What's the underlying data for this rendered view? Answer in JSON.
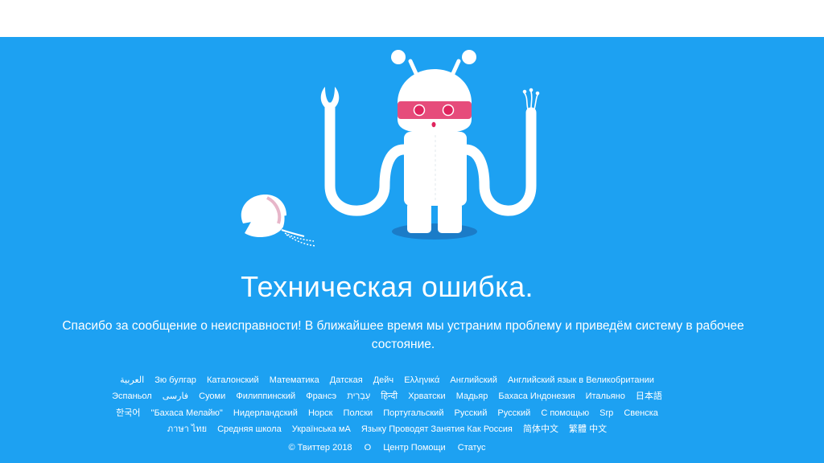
{
  "colors": {
    "background": "#1da1f2",
    "robot_body": "#ffffff",
    "visor": "#e0245e",
    "shadow": "#1b7cc8"
  },
  "illustration": {
    "name": "broken-twitter-robot",
    "icon": "robot-icon"
  },
  "error": {
    "title": "Техническая ошибка.",
    "message": "Спасибо за сообщение о неисправности! В ближайшее время мы устраним проблему и приведём систему в рабочее состояние."
  },
  "languages": [
    "العربية",
    "Зю булгар",
    "Каталонский",
    "Математика",
    "Датская",
    "Дейч",
    "Ελληνικά",
    "Английский",
    "Английский язык в Великобритании",
    "Эспаньол",
    "فارسی",
    "Суоми",
    "Филиппинский",
    "Франсэ",
    "עִבְרִית",
    "हिन्दी",
    "Хрватски",
    "Мадьяр",
    "Бахаса Индонезия",
    "Итальяно",
    "日本語",
    "한국어",
    "\"Бахаса Мелайю\"",
    "Нидерландский",
    "Норск",
    "Полски",
    "Португальский",
    "Русский",
    "Русский",
    "С помощью",
    "Srp",
    "Свенска",
    "ภาษา ไทย",
    "Средняя школа",
    "Українська мА",
    "Языку Проводят Занятия Как Россия",
    "简体中文",
    "繁體 中文"
  ],
  "footer": {
    "copyright": "© Твиттер 2018",
    "about": "О",
    "help": "Центр Помощи",
    "status": "Статус"
  }
}
